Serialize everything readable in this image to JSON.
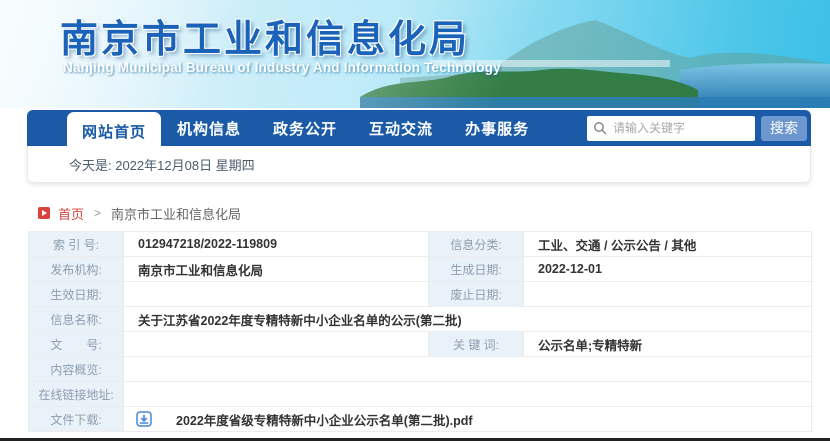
{
  "header": {
    "title": "南京市工业和信息化局",
    "subtitle": "Nanjing Municipal Bureau of Industry And Information Technology"
  },
  "nav": {
    "tabs": [
      "网站首页",
      "机构信息",
      "政务公开",
      "互动交流",
      "办事服务"
    ]
  },
  "search": {
    "placeholder": "请输入关键字",
    "button_label": "搜索"
  },
  "date_bar": {
    "text": "今天是: 2022年12月08日 星期四"
  },
  "breadcrumb": {
    "home": "首页",
    "separator": ">",
    "current": "南京市工业和信息化局"
  },
  "info_table": {
    "rows": [
      {
        "left_label": "索 引 号:",
        "left_value": "012947218/2022-119809",
        "right_label": "信息分类:",
        "right_value": "工业、交通 / 公示公告 / 其他"
      },
      {
        "left_label": "发布机构:",
        "left_value": "南京市工业和信息化局",
        "right_label": "生成日期:",
        "right_value": "2022-12-01"
      },
      {
        "left_label": "生效日期:",
        "left_value": "",
        "right_label": "废止日期:",
        "right_value": ""
      },
      {
        "left_label": "信息名称:",
        "left_value": "关于江苏省2022年度专精特新中小企业名单的公示(第二批)"
      },
      {
        "left_label": "文　　号:",
        "left_value": "",
        "right_label": "关 键 词:",
        "right_value": "公示名单;专精特新"
      },
      {
        "left_label": "内容概览:",
        "left_value": ""
      },
      {
        "left_label": "在线链接地址:",
        "left_value": ""
      },
      {
        "left_label": "文件下载:",
        "file_name": "2022年度省级专精特新中小企业公示名单(第二批).pdf"
      }
    ]
  },
  "colors": {
    "nav_blue": "#1a5aa6",
    "title_blue": "#1b63b8",
    "search_btn_blue": "#6d98cf",
    "accent_red": "#d9413d",
    "label_bg": "#eaf2f9",
    "label_text": "#8b9dae",
    "download_icon_blue": "#4285d8"
  }
}
